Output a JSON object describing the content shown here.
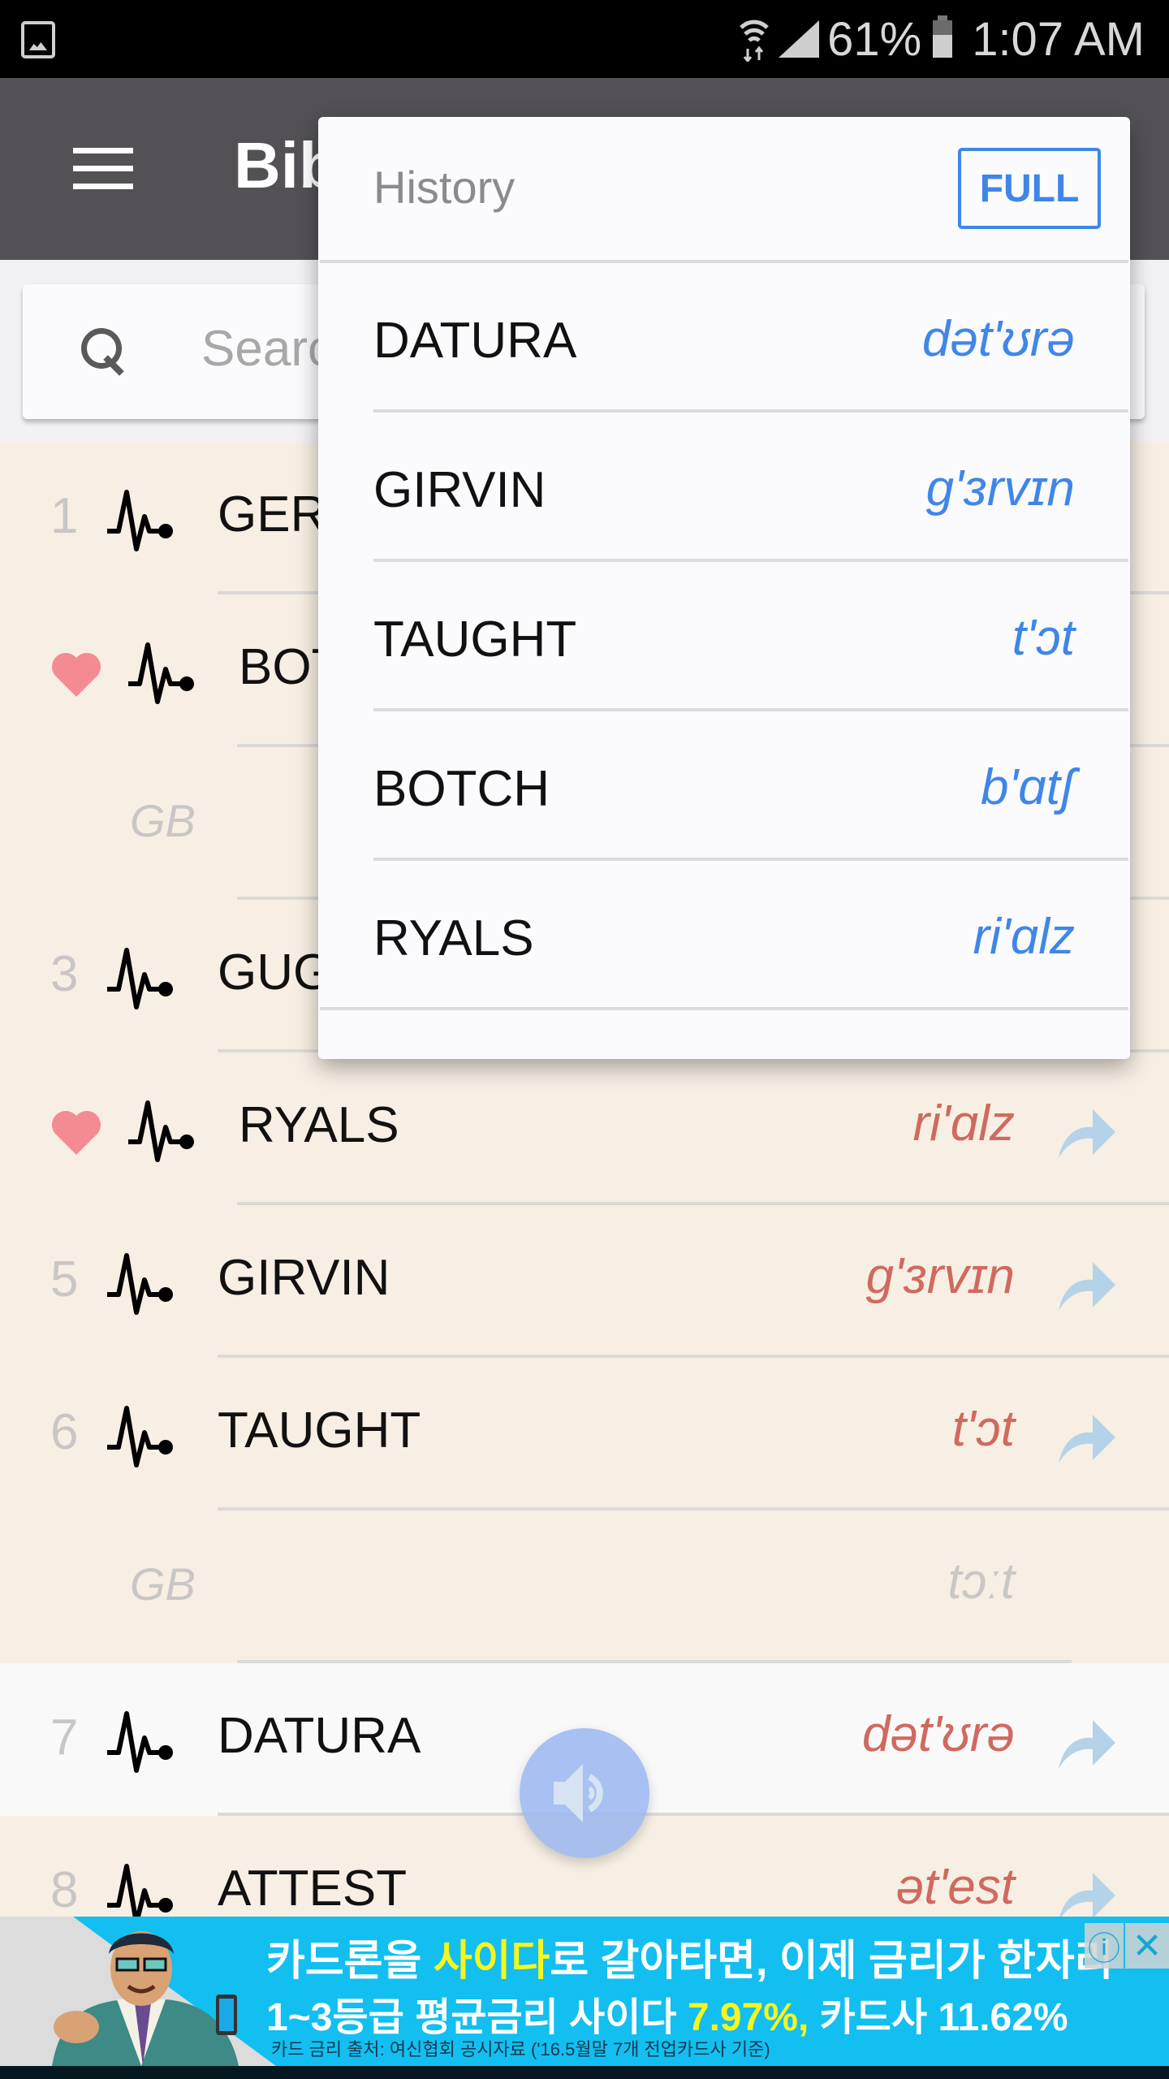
{
  "status_bar": {
    "left_icon": "image-notification-icon",
    "battery_percent": "61%",
    "time": "1:07 AM",
    "icons": [
      "wifi-icon",
      "signal-icon",
      "battery-icon"
    ]
  },
  "app_bar": {
    "menu_icon": "hamburger-icon",
    "title": "Bib"
  },
  "search": {
    "placeholder": "Search"
  },
  "colors": {
    "accent_blue": "#3f86e8",
    "ipa_red": "#d0695f",
    "heart_pink": "#f48b93",
    "list_background": "#f7efe3",
    "app_bar": "#535155",
    "ad_background": "#12bff0"
  },
  "list": {
    "rows": [
      {
        "index": "1",
        "favorite": false,
        "word": "GERT",
        "ipa": ""
      },
      {
        "index": "",
        "favorite": true,
        "word": "BOT",
        "ipa": ""
      },
      {
        "index": "",
        "favorite": false,
        "region": "GB",
        "word": "",
        "ipa": ""
      },
      {
        "index": "3",
        "favorite": false,
        "word": "GUG",
        "ipa": ""
      },
      {
        "index": "",
        "favorite": true,
        "word": "RYALS",
        "ipa": "ri'ɑlz"
      },
      {
        "index": "5",
        "favorite": false,
        "word": "GIRVIN",
        "ipa": "g'ɜrvɪn"
      },
      {
        "index": "6",
        "favorite": false,
        "word": "TAUGHT",
        "ipa": "t'ɔt"
      },
      {
        "index": "",
        "favorite": false,
        "region": "GB",
        "word": "",
        "ipa": "tɔːt"
      },
      {
        "index": "7",
        "favorite": false,
        "word": "DATURA",
        "ipa": "dət'ʊrə"
      },
      {
        "index": "8",
        "favorite": false,
        "word": "ATTEST",
        "ipa": "ət'est"
      }
    ]
  },
  "history_popup": {
    "title": "History",
    "full_button": "FULL",
    "items": [
      {
        "word": "DATURA",
        "ipa": "dət'ʊrə"
      },
      {
        "word": "GIRVIN",
        "ipa": "g'ɜrvɪn"
      },
      {
        "word": "TAUGHT",
        "ipa": "t'ɔt"
      },
      {
        "word": "BOTCH",
        "ipa": "b'ɑtʃ"
      },
      {
        "word": "RYALS",
        "ipa": "ri'ɑlz"
      }
    ]
  },
  "fab": {
    "icon": "speaker-icon"
  },
  "ad": {
    "line1_a": "카드론을 ",
    "line1_highlight": "사이다",
    "line1_b": "로 갈아타면, 이제 금리가 한자리",
    "line2_a": "1~3등급 평균금리 사이다 ",
    "line2_highlight": "7.97%,",
    "line2_b": " 카드사 11.62%",
    "line3": "카드 금리 출처: 여신협회 공시자료 ('16.5월말 7개 전업카드사 기준)",
    "info_label": "ⓘ",
    "close_label": "✕"
  }
}
